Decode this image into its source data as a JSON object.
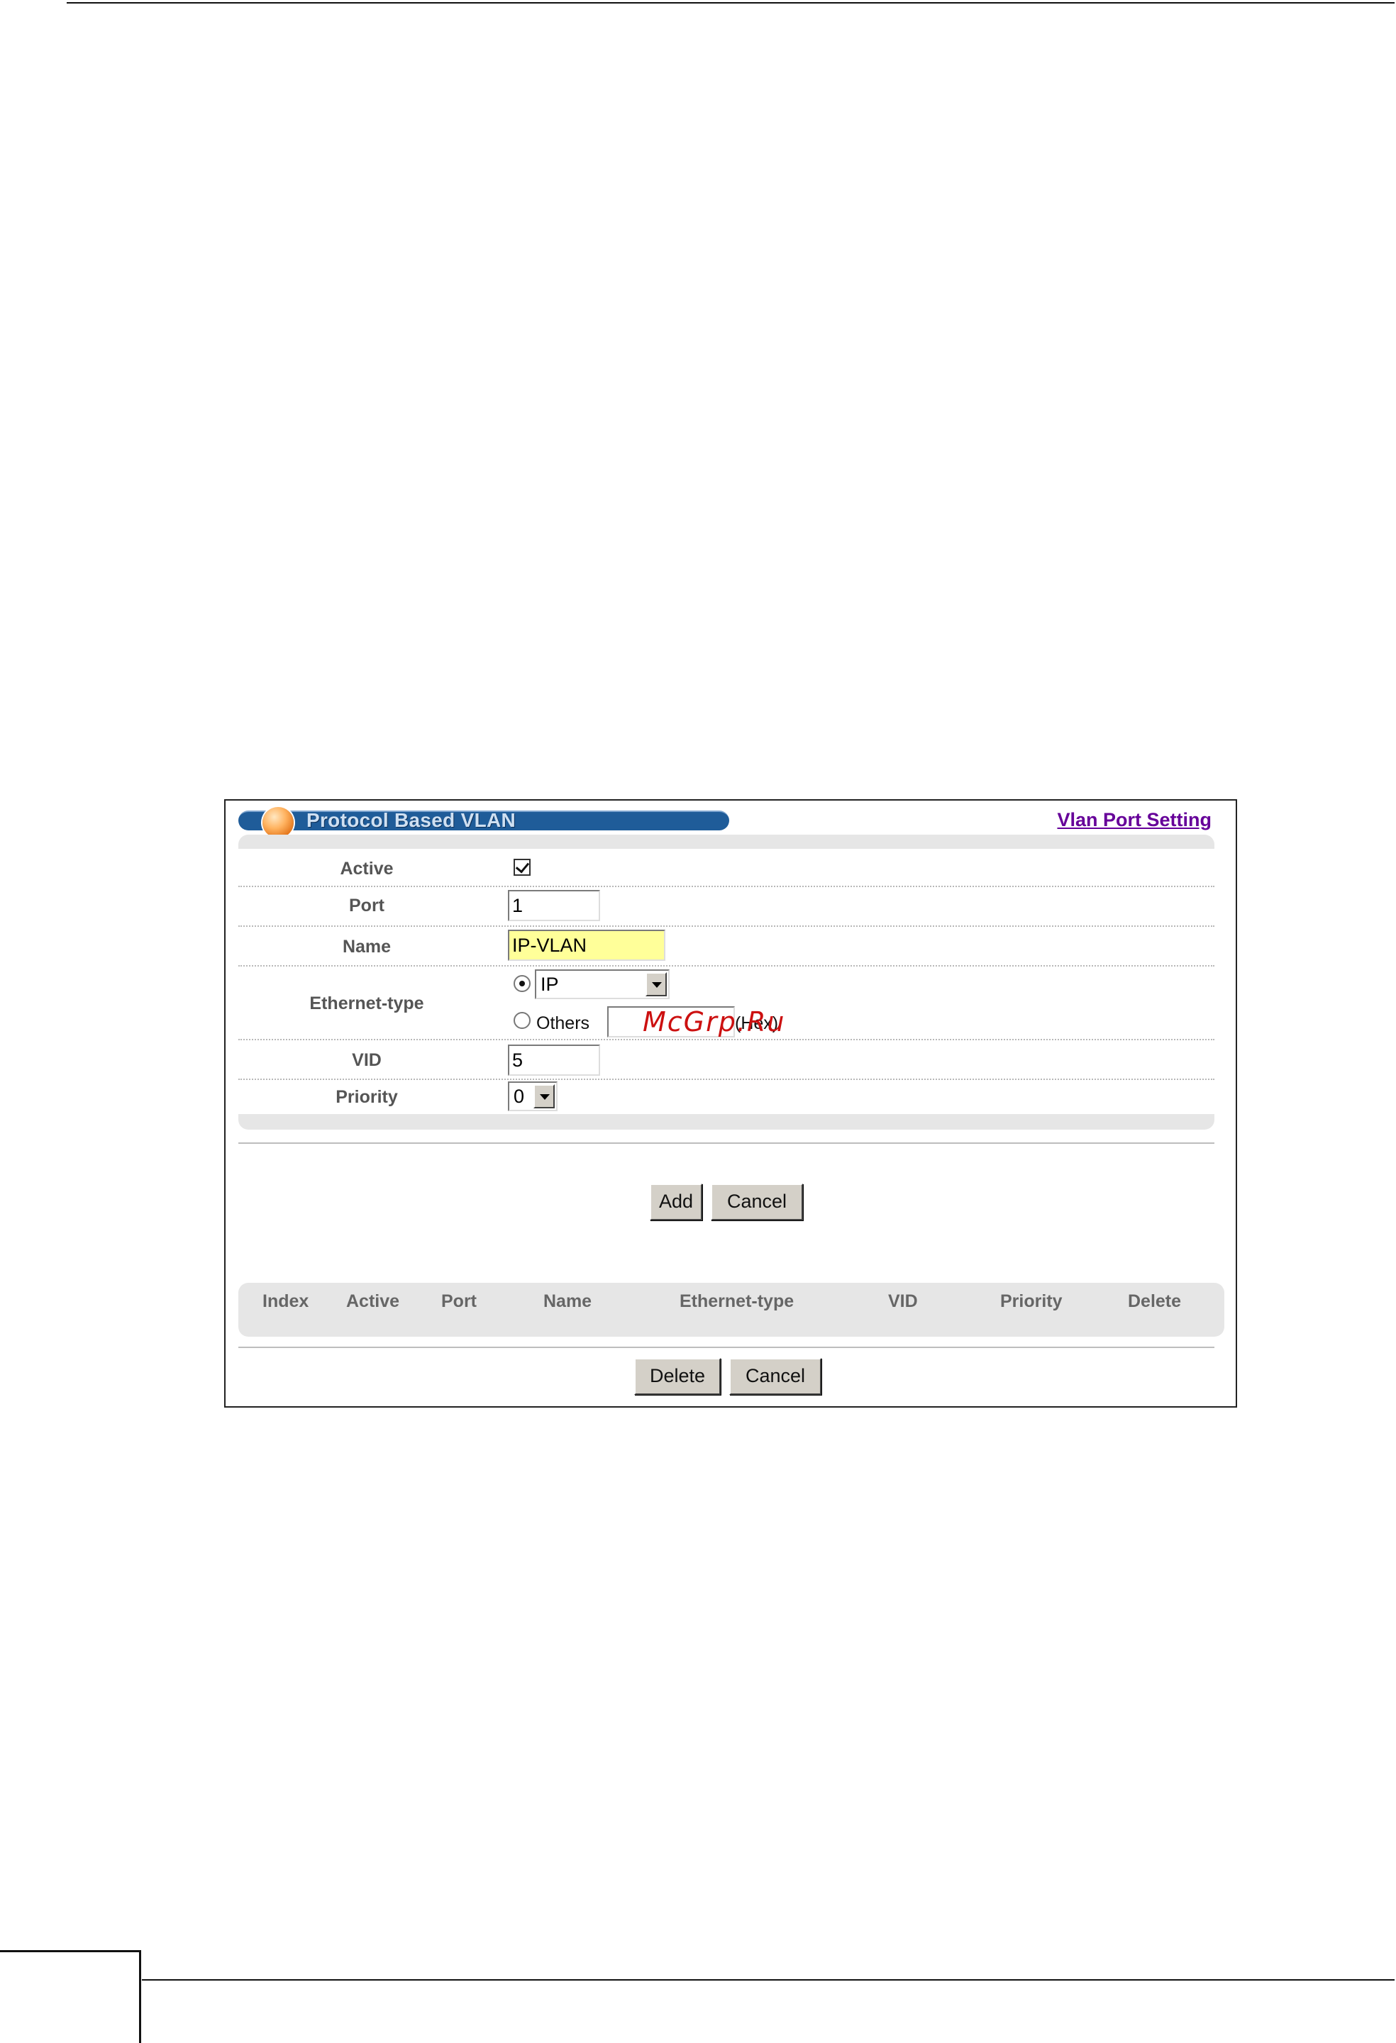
{
  "panel": {
    "title": "Protocol Based VLAN",
    "link_label": "Vlan Port Setting"
  },
  "form": {
    "active_label": "Active",
    "active_checked": true,
    "port_label": "Port",
    "port_value": "1",
    "name_label": "Name",
    "name_value": "IP-VLAN",
    "ethertype_label": "Ethernet-type",
    "ethertype_select_value": "IP",
    "others_label": "Others",
    "others_value": "",
    "hex_suffix": "(Hex)",
    "vid_label": "VID",
    "vid_value": "5",
    "priority_label": "Priority",
    "priority_value": "0"
  },
  "buttons": {
    "add": "Add",
    "cancel_top": "Cancel",
    "delete": "Delete",
    "cancel_bottom": "Cancel"
  },
  "table": {
    "columns": [
      "Index",
      "Active",
      "Port",
      "Name",
      "Ethernet-type",
      "VID",
      "Priority",
      "Delete"
    ]
  },
  "watermark": "McGrp.Ru"
}
